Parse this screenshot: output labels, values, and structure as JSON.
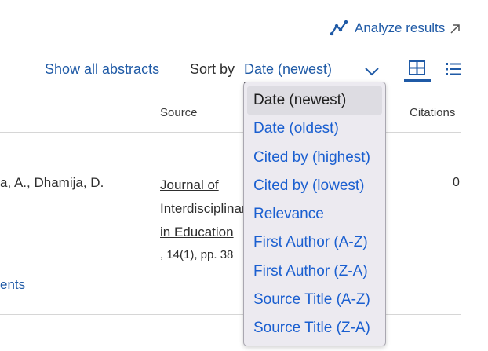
{
  "analyze": {
    "label": "Analyze results",
    "icon": "line-chart-icon",
    "arrow_icon": "external-arrow-icon"
  },
  "toolbar": {
    "show_abstracts": "Show all abstracts",
    "sort_label": "Sort by",
    "sort_value": "Date (newest)",
    "view_grid_icon": "grid-view-icon",
    "view_list_icon": "list-view-icon"
  },
  "table": {
    "headers": {
      "source": "Source",
      "citations": "Citations"
    },
    "row": {
      "author_prefix": "a, A.",
      "author_sep": ", ",
      "author2": "Dhamija, D.",
      "source_lines": [
        "Journal of",
        "Interdisciplinary",
        "in Education"
      ],
      "volume": ", 14(1), pp. 38",
      "citations": "0",
      "more_link": "ents"
    }
  },
  "dropdown": {
    "options": [
      "Date (newest)",
      "Date (oldest)",
      "Cited by (highest)",
      "Cited by (lowest)",
      "Relevance",
      "First Author (A-Z)",
      "First Author (Z-A)",
      "Source Title (A-Z)",
      "Source Title (Z-A)"
    ],
    "selected_index": 0
  },
  "colors": {
    "link_blue": "#1f5aa6",
    "option_blue": "#1a5fd0",
    "dropdown_bg": "#eceaf0",
    "selected_bg": "#dddce2"
  }
}
